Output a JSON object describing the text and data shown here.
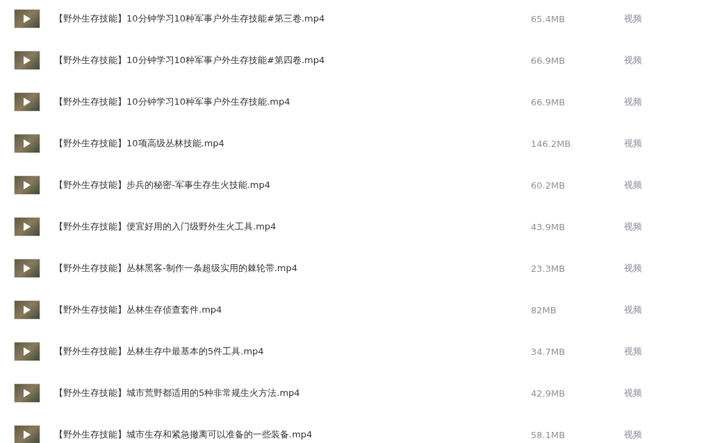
{
  "files": [
    {
      "name": "【野外生存技能】10分钟学习10种军事户外生存技能#第三卷.mp4",
      "size": "65.4MB",
      "type": "视频"
    },
    {
      "name": "【野外生存技能】10分钟学习10种军事户外生存技能#第四卷.mp4",
      "size": "66.9MB",
      "type": "视频"
    },
    {
      "name": "【野外生存技能】10分钟学习10种军事户外生存技能.mp4",
      "size": "66.9MB",
      "type": "视频"
    },
    {
      "name": "【野外生存技能】10项高级丛林技能.mp4",
      "size": "146.2MB",
      "type": "视频"
    },
    {
      "name": "【野外生存技能】步兵的秘密-军事生存生火技能.mp4",
      "size": "60.2MB",
      "type": "视频"
    },
    {
      "name": "【野外生存技能】便宜好用的入门级野外生火工具.mp4",
      "size": "43.9MB",
      "type": "视频"
    },
    {
      "name": "【野外生存技能】丛林黑客-制作一条超级实用的棘轮带.mp4",
      "size": "23.3MB",
      "type": "视频"
    },
    {
      "name": "【野外生存技能】丛林生存侦查套件.mp4",
      "size": "82MB",
      "type": "视频"
    },
    {
      "name": "【野外生存技能】丛林生存中最基本的5件工具.mp4",
      "size": "34.7MB",
      "type": "视频"
    },
    {
      "name": "【野外生存技能】城市荒野都适用的5种非常规生火方法.mp4",
      "size": "42.9MB",
      "type": "视频"
    },
    {
      "name": "【野外生存技能】城市生存和紧急撤离可以准备的一些装备.mp4",
      "size": "58.1MB",
      "type": "视频"
    }
  ]
}
